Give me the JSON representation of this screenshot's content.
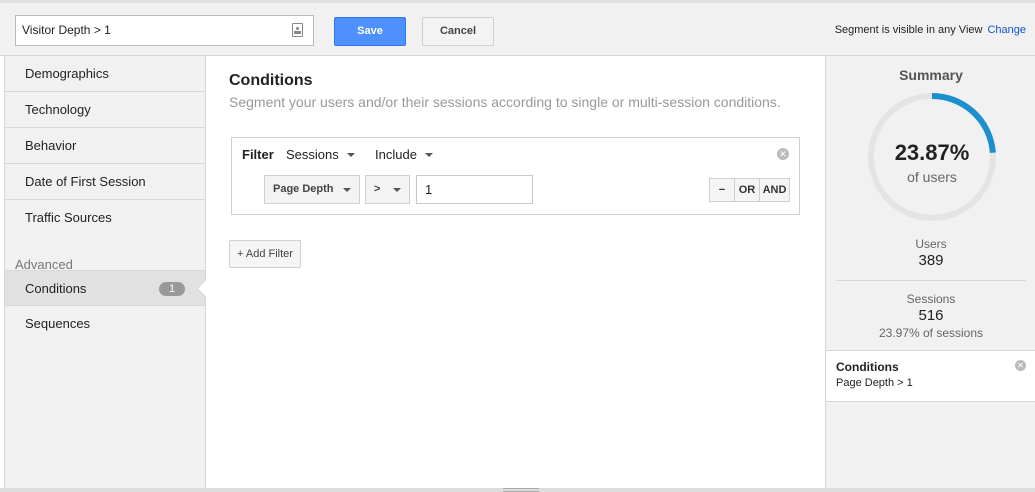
{
  "header": {
    "segment_name": "Visitor Depth > 1",
    "save_label": "Save",
    "cancel_label": "Cancel",
    "visibility_text": "Segment is visible in any View",
    "change_label": "Change"
  },
  "sidebar": {
    "items": [
      {
        "label": "Demographics"
      },
      {
        "label": "Technology"
      },
      {
        "label": "Behavior"
      },
      {
        "label": "Date of First Session"
      },
      {
        "label": "Traffic Sources"
      }
    ],
    "advanced_heading": "Advanced",
    "advanced_items": [
      {
        "label": "Conditions",
        "badge": "1"
      },
      {
        "label": "Sequences"
      }
    ]
  },
  "main": {
    "title": "Conditions",
    "description": "Segment your users and/or their sessions according to single or multi-session conditions.",
    "filter": {
      "label": "Filter",
      "scope": "Sessions",
      "mode": "Include",
      "dimension": "Page Depth",
      "operator": ">",
      "value": "1",
      "logic_minus": "−",
      "logic_or": "OR",
      "logic_and": "AND"
    },
    "add_filter_label": "+ Add Filter"
  },
  "summary": {
    "title": "Summary",
    "percent": "23.87%",
    "percent_value": 23.87,
    "percent_sub": "of users",
    "users_label": "Users",
    "users_value": "389",
    "sessions_label": "Sessions",
    "sessions_value": "516",
    "sessions_pct": "23.97% of sessions",
    "conditions_title": "Conditions",
    "conditions_text": "Page Depth > 1"
  },
  "colors": {
    "accent": "#4d90fe",
    "donut_fill": "#1c8fce",
    "donut_track": "#e4e4e4",
    "link": "#1155cc"
  }
}
